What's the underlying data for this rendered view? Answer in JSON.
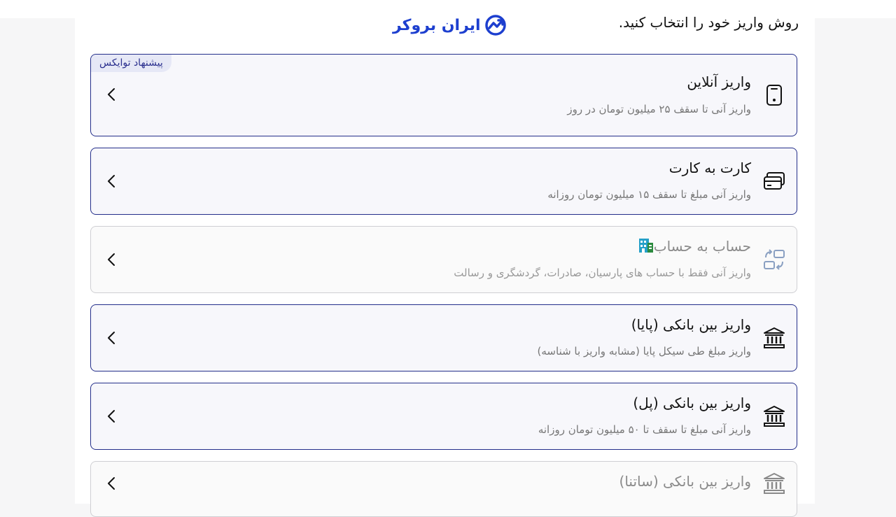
{
  "header": {
    "title": "روش واریز خود را انتخاب کنید.",
    "logo_text": "ایران بروکر"
  },
  "colors": {
    "accent": "#232e8a",
    "logo": "#1d3fcf",
    "badge_bg": "#e6e8f6"
  },
  "methods": [
    {
      "label": "واریز آنلاین",
      "sub": "واریز آنی تا سقف ۲۵ میلیون تومان در روز",
      "badge": "پیشنهاد توایکس",
      "icon": "phone-icon",
      "enabled": true
    },
    {
      "label": "کارت به کارت",
      "sub": "واریز آنی مبلغ تا سقف ۱۵ میلیون تومان روزانه",
      "icon": "card-icon",
      "enabled": true
    },
    {
      "label": "حساب به حساب",
      "sub": "واریز آنی فقط با حساب های پارسیان، صادرات، گردشگری و رسالت",
      "icon": "account-transfer-icon",
      "enabled": false
    },
    {
      "label": "واریز بین بانکی (پایا)",
      "sub": "واریز مبلغ طی سیکل پایا (مشابه واریز با شناسه)",
      "icon": "bank-icon",
      "enabled": true
    },
    {
      "label": "واریز بین بانکی (پل)",
      "sub": "واریز آنی مبلغ تا سقف تا ۵۰ میلیون تومان روزانه",
      "icon": "bank-icon",
      "enabled": true
    },
    {
      "label": "واریز بین بانکی (ساتنا)",
      "icon": "bank-icon",
      "enabled": false
    }
  ]
}
